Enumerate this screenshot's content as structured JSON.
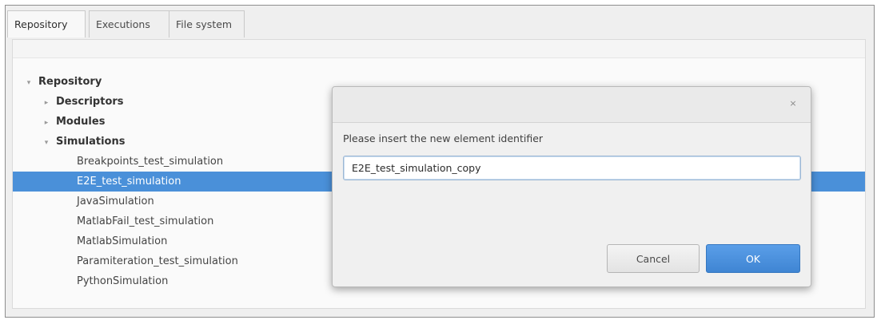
{
  "tabs": [
    {
      "label": "Repository",
      "active": true
    },
    {
      "label": "Executions",
      "active": false
    },
    {
      "label": "File system",
      "active": false
    }
  ],
  "tree": {
    "root": {
      "label": "Repository",
      "expanded": true
    },
    "descriptors": {
      "label": "Descriptors",
      "expanded": false
    },
    "modules": {
      "label": "Modules",
      "expanded": false
    },
    "simulations": {
      "label": "Simulations",
      "expanded": true,
      "items": [
        "Breakpoints_test_simulation",
        "E2E_test_simulation",
        "JavaSimulation",
        "MatlabFail_test_simulation",
        "MatlabSimulation",
        "Paramiteration_test_simulation",
        "PythonSimulation"
      ],
      "selected_index": 1
    }
  },
  "dialog": {
    "close_glyph": "×",
    "prompt": "Please insert the new element identifier",
    "input_value": "E2E_test_simulation_copy",
    "cancel_label": "Cancel",
    "ok_label": "OK"
  },
  "colors": {
    "selection": "#4a90d9",
    "ok_button": "#4a90d9"
  }
}
